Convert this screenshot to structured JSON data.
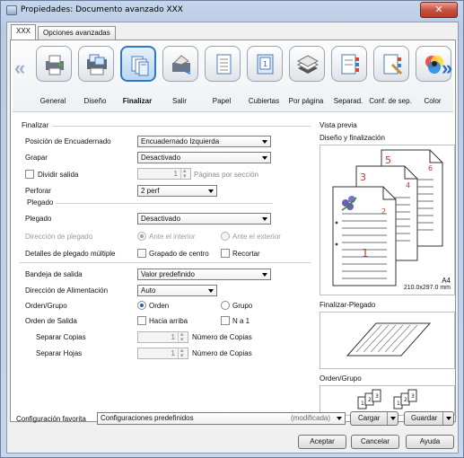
{
  "window": {
    "title": "Propiedades: Documento avanzado XXX",
    "close_label": "✕"
  },
  "tabs": [
    {
      "label": "XXX",
      "active": true
    },
    {
      "label": "Opciones avanzadas",
      "active": false
    }
  ],
  "toolbar": {
    "items": [
      {
        "label": "General",
        "icon": "printer-general-icon"
      },
      {
        "label": "Diseño",
        "icon": "layout-icon"
      },
      {
        "label": "Finalizar",
        "icon": "finishing-icon",
        "selected": true
      },
      {
        "label": "Salir",
        "icon": "output-icon"
      },
      {
        "label": "Papel",
        "icon": "paper-icon"
      },
      {
        "label": "Cubiertas",
        "icon": "covers-icon"
      },
      {
        "label": "Por página",
        "icon": "per-page-icon"
      },
      {
        "label": "Separad.",
        "icon": "separators-icon"
      },
      {
        "label": "Conf. de sep.",
        "icon": "separator-config-icon"
      },
      {
        "label": "Color",
        "icon": "color-icon"
      }
    ]
  },
  "finalizar": {
    "section_title": "Finalizar",
    "binding_position": {
      "label": "Posición de Encuadernado",
      "value": "Encuadernado Izquierda"
    },
    "staple": {
      "label": "Grapar",
      "value": "Desactivado"
    },
    "split_output": {
      "label": "Dividir salida",
      "checked": false,
      "pages_value": "1",
      "pages_unit": "Páginas por sección"
    },
    "punch": {
      "label": "Perforar",
      "value": "2 perf"
    },
    "plegado_title": "Plegado",
    "fold": {
      "label": "Plegado",
      "value": "Desactivado"
    },
    "fold_direction": {
      "label": "Dirección de plegado",
      "option1": "Ante el interior",
      "option2": "Ante el exterior"
    },
    "fold_details": {
      "label": "Detalles de plegado múltiple",
      "center_staple": "Grapado de centro",
      "trim": "Recortar"
    }
  },
  "output": {
    "tray": {
      "label": "Bandeja de salida",
      "value": "Valor predefinido"
    },
    "feed_direction": {
      "label": "Dirección de Alimentación",
      "value": "Auto"
    },
    "order_group": {
      "label": "Orden/Grupo",
      "option1": "Orden",
      "option2": "Grupo"
    },
    "output_order": {
      "label": "Orden de Salida",
      "face_up": "Hacia arriba",
      "n_to_1": "N a 1"
    },
    "separate_copies": {
      "label": "Separar Copias",
      "value": "1",
      "unit": "Número de Copias"
    },
    "separate_sheets": {
      "label": "Separar Hojas",
      "value": "1",
      "unit": "Número de Copias"
    }
  },
  "preview": {
    "title": "Vista previa",
    "subtitle": "Diseño y finalización",
    "paper_size_line1": "A4",
    "paper_size_line2": "210.0x297.0 mm",
    "page_numbers": [
      "1",
      "2",
      "3",
      "4",
      "5",
      "6"
    ],
    "fold_caption": "Finalizar-Plegado",
    "order_caption": "Orden/Grupo"
  },
  "bottom": {
    "favorites_label": "Configuración favorita",
    "favorites_value": "Configuraciones predefinidos",
    "favorites_modified": "(modificada)",
    "load_button": "Cargar",
    "save_button": "Guardar",
    "accept_button": "Aceptar",
    "cancel_button": "Cancelar",
    "help_button": "Ayuda"
  },
  "colors": {
    "accent": "#2c78c9",
    "page_number_red": "#c0392b"
  }
}
